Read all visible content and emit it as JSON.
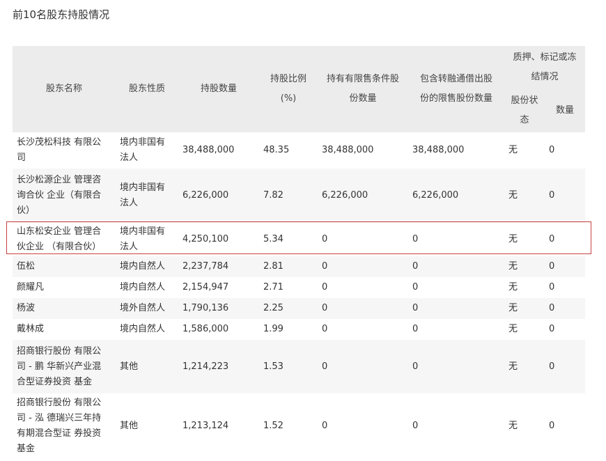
{
  "title": "前10名股东持股情况",
  "headers": {
    "name": "股东名称",
    "nature": "股东性质",
    "shares": "持股数量",
    "ratio_line1": "持股比例",
    "ratio_line2": "(%)",
    "restricted_line1": "持有有限售条件股",
    "restricted_line2": "份数量",
    "lending_line1": "包含转融通借出股",
    "lending_line2": "份的限售股份数量",
    "pledge_line1": "质押、标记或冻",
    "pledge_line2": "结情况",
    "pledge_status_line1": "股份状",
    "pledge_status_line2": "态",
    "pledge_qty": "数量"
  },
  "rows": [
    {
      "name_lines": [
        "长沙茂松科技 有限公",
        "司"
      ],
      "nature_lines": [
        "境内非国有",
        "法人"
      ],
      "shares": "38,488,000",
      "ratio": "48.35",
      "restricted": "38,488,000",
      "lending": "38,488,000",
      "status": "无",
      "qty": "0"
    },
    {
      "name_lines": [
        "长沙松源企业 管理咨",
        "询合伙 企业（有限合",
        "伙）"
      ],
      "nature_lines": [
        "境内非国有",
        "法人"
      ],
      "shares": "6,226,000",
      "ratio": "7.82",
      "restricted": "6,226,000",
      "lending": "6,226,000",
      "status": "无",
      "qty": "0"
    },
    {
      "name_lines": [
        "山东松安企业 管理合",
        "伙企业 （有限合伙）"
      ],
      "nature_lines": [
        "境内非国有",
        "法人"
      ],
      "shares": "4,250,100",
      "ratio": "5.34",
      "restricted": "0",
      "lending": "0",
      "status": "无",
      "qty": "0"
    },
    {
      "name_lines": [
        "伍松"
      ],
      "nature_lines": [
        "境内自然人"
      ],
      "shares": "2,237,784",
      "ratio": "2.81",
      "restricted": "0",
      "lending": "0",
      "status": "无",
      "qty": "0"
    },
    {
      "name_lines": [
        "颜耀凡"
      ],
      "nature_lines": [
        "境内自然人"
      ],
      "shares": "2,154,947",
      "ratio": "2.71",
      "restricted": "0",
      "lending": "0",
      "status": "无",
      "qty": "0"
    },
    {
      "name_lines": [
        "杨波"
      ],
      "nature_lines": [
        "境外自然人"
      ],
      "shares": "1,790,136",
      "ratio": "2.25",
      "restricted": "0",
      "lending": "0",
      "status": "无",
      "qty": "0"
    },
    {
      "name_lines": [
        "戴林成"
      ],
      "nature_lines": [
        "境内自然人"
      ],
      "shares": "1,586,000",
      "ratio": "1.99",
      "restricted": "0",
      "lending": "0",
      "status": "无",
      "qty": "0"
    },
    {
      "name_lines": [
        "招商银行股份 有限公",
        "司 - 鹏 华新兴产业混",
        "合型证券投资 基金"
      ],
      "nature_lines": [
        "其他"
      ],
      "shares": "1,214,223",
      "ratio": "1.53",
      "restricted": "0",
      "lending": "0",
      "status": "无",
      "qty": "0"
    },
    {
      "name_lines": [
        "招商银行股份 有限公",
        "司 - 泓 德瑞兴三年持",
        "有期混合型证 券投资",
        "基金"
      ],
      "nature_lines": [
        "其他"
      ],
      "shares": "1,213,124",
      "ratio": "1.52",
      "restricted": "0",
      "lending": "0",
      "status": "无",
      "qty": "0"
    }
  ]
}
